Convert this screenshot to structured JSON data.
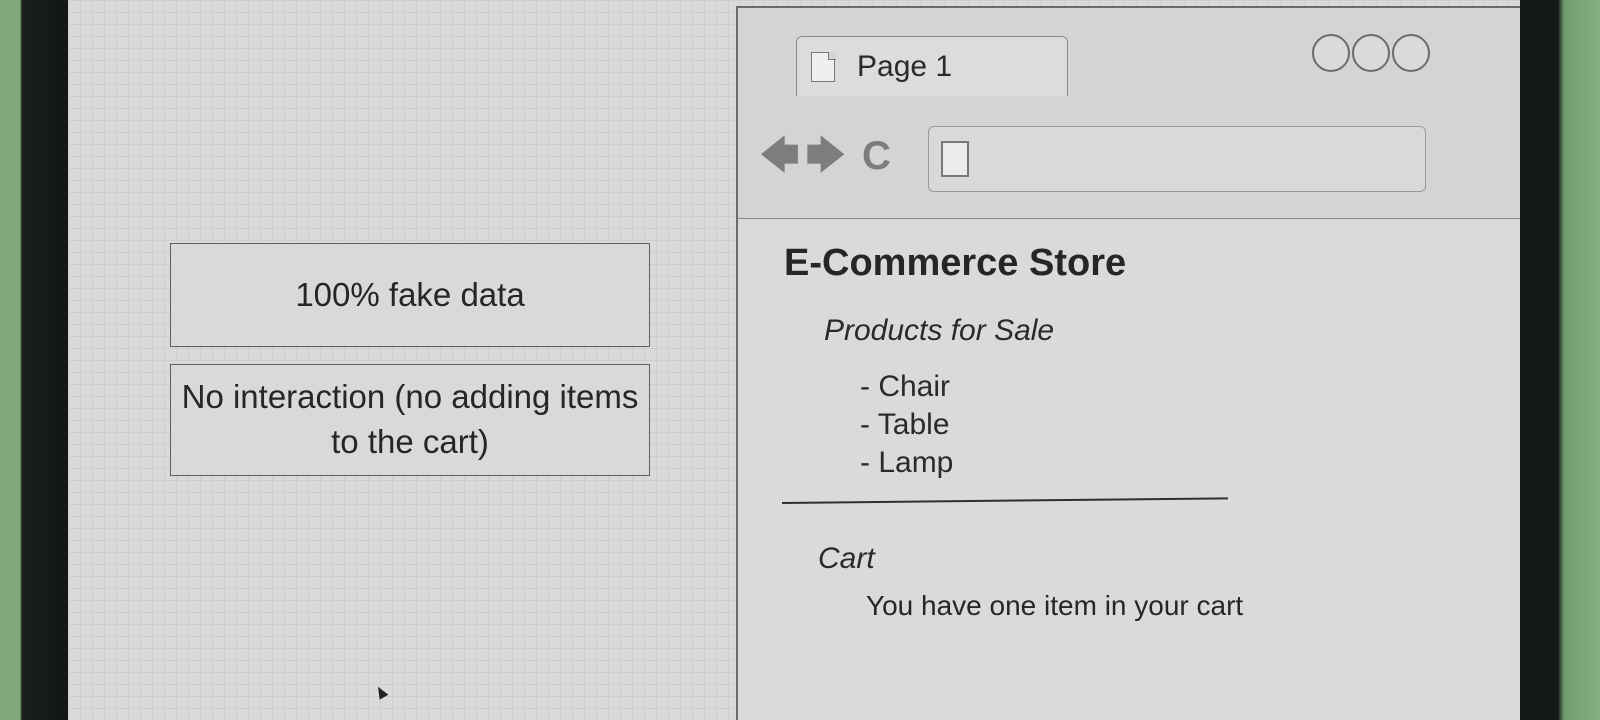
{
  "notes": [
    {
      "text": "100% fake data"
    },
    {
      "text": "No interaction (no adding items to the cart)"
    }
  ],
  "browser": {
    "tab": {
      "label": "Page 1",
      "icon": "document-icon"
    },
    "window_controls": [
      "circle",
      "circle",
      "circle"
    ],
    "nav": {
      "back_icon": "back-arrow-icon",
      "forward_icon": "forward-arrow-icon",
      "reload_icon": "reload-icon",
      "address_value": ""
    }
  },
  "page": {
    "title": "E-Commerce Store",
    "products_heading": "Products for Sale",
    "products": [
      "- Chair",
      "- Table",
      "- Lamp"
    ],
    "cart_heading": "Cart",
    "cart_message": "You have one item in your cart"
  }
}
